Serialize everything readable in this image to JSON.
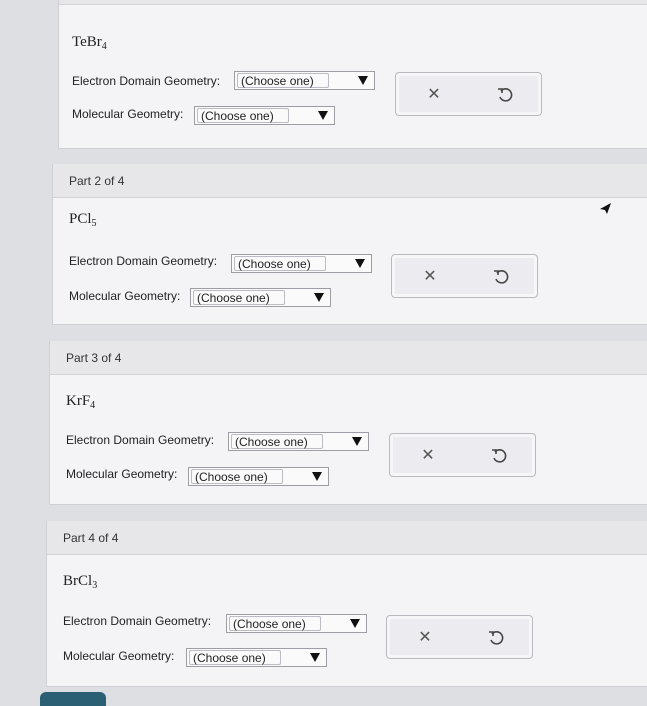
{
  "parts": [
    {
      "header": "",
      "formula": {
        "base": "TeBr",
        "sub": "4"
      },
      "electron_label": "Electron Domain Geometry:",
      "electron_value": "(Choose one)",
      "molecular_label": "Molecular Geometry:",
      "molecular_value": "(Choose one)"
    },
    {
      "header": "Part 2 of 4",
      "formula": {
        "base": "PCl",
        "sub": "5"
      },
      "electron_label": "Electron Domain Geometry:",
      "electron_value": "(Choose one)",
      "molecular_label": "Molecular Geometry:",
      "molecular_value": "(Choose one)"
    },
    {
      "header": "Part 3 of 4",
      "formula": {
        "base": "KrF",
        "sub": "4"
      },
      "electron_label": "Electron Domain Geometry:",
      "electron_value": "(Choose one)",
      "molecular_label": "Molecular Geometry:",
      "molecular_value": "(Choose one)"
    },
    {
      "header": "Part 4 of 4",
      "formula": {
        "base": "BrCl",
        "sub": "3"
      },
      "electron_label": "Electron Domain Geometry:",
      "electron_value": "(Choose one)",
      "molecular_label": "Molecular Geometry:",
      "molecular_value": "(Choose one)"
    }
  ],
  "icons": {
    "clear": "close-icon",
    "reset": "undo-icon",
    "dropdown": "triangle-down-icon"
  },
  "colors": {
    "accent_button": "#2b5f73",
    "page_background": "#dedfe3",
    "panel_background": "#f4f4f6"
  }
}
